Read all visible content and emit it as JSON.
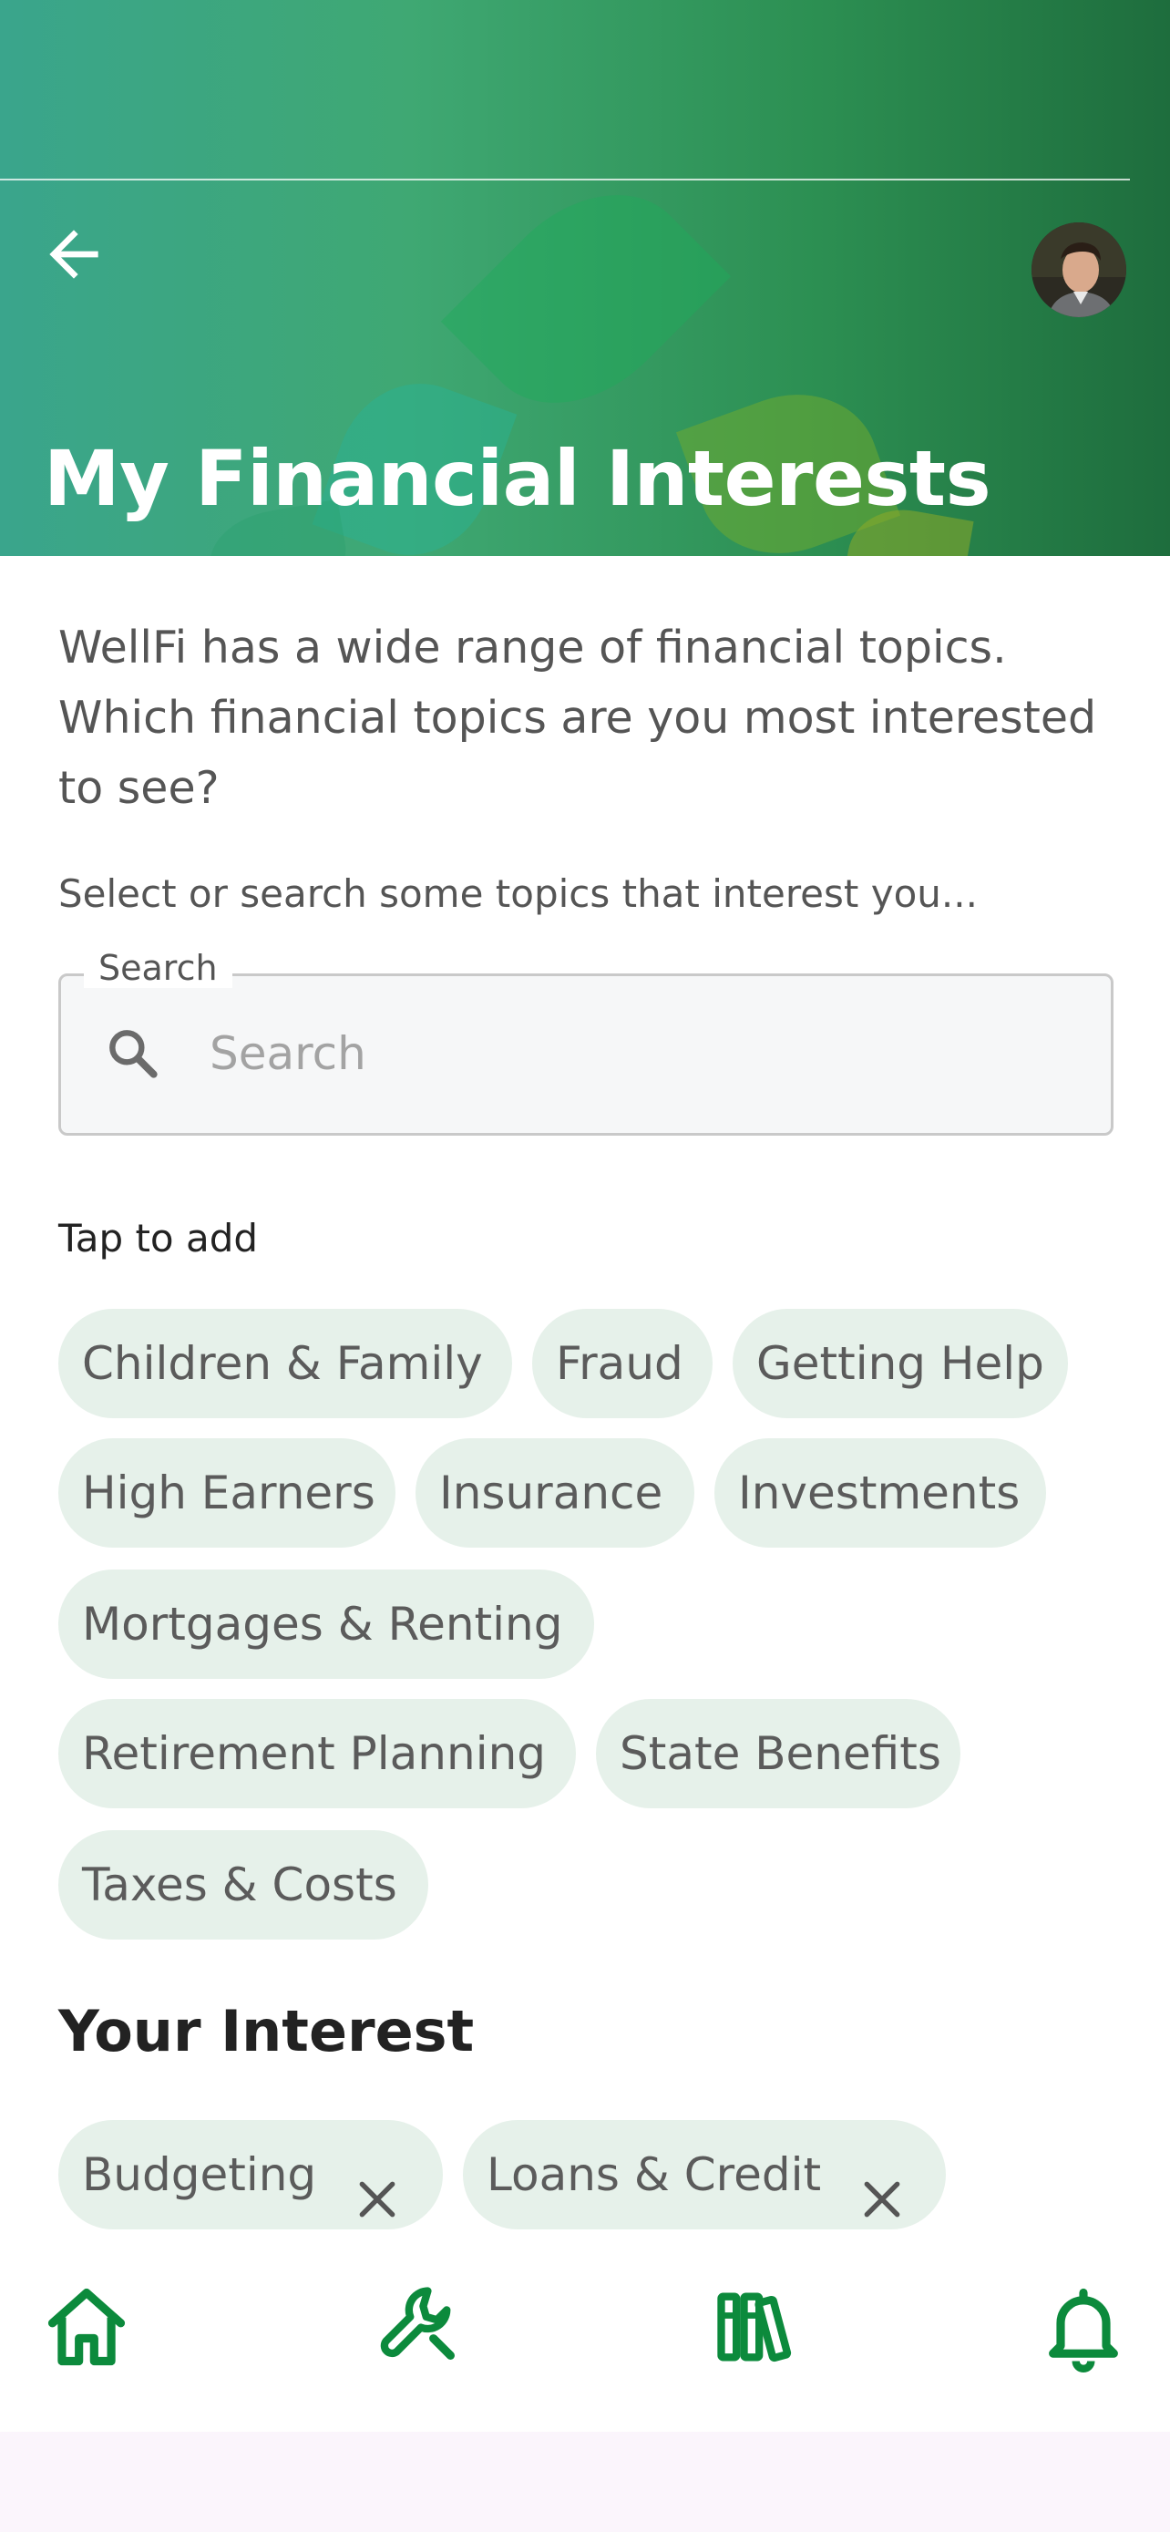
{
  "header": {
    "title": "My Financial Interests",
    "back_icon": "arrow-left-icon",
    "avatar": "user-avatar-photo"
  },
  "intro": {
    "text": "WellFi has a wide range of financial topics. Which financial topics are you most interested to see?",
    "prompt": "Select or search some topics that interest you..."
  },
  "search": {
    "legend": "Search",
    "placeholder": "Search",
    "value": "",
    "icon": "search-icon"
  },
  "topics": {
    "label": "Tap to add",
    "items": [
      "Children & Family",
      "Fraud",
      "Getting Help",
      "High Earners",
      "Insurance",
      "Investments",
      "Mortgages & Renting",
      "Retirement Planning",
      "State Benefits",
      "Taxes & Costs"
    ]
  },
  "your_interests": {
    "title": "Your Interest",
    "items": [
      "Budgeting",
      "Loans & Credit"
    ],
    "remove_icon": "close-icon"
  },
  "nav": {
    "items": [
      "home-icon",
      "wrench-icon",
      "library-icon",
      "bell-icon"
    ]
  },
  "colors": {
    "brand_green": "#0c8a3c",
    "chip_bg": "#e6f1ea",
    "chip_text": "#5b5b5b"
  }
}
